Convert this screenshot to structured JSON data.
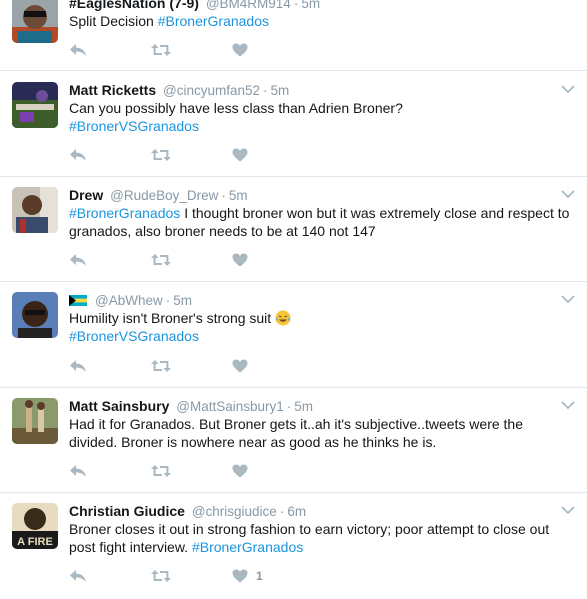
{
  "colors": {
    "accent": "#1b95e0",
    "muted": "#8899a6",
    "border": "#e1e8ed",
    "text": "#14171a"
  },
  "tweets": [
    {
      "name": "#EaglesNation (7-9)",
      "handle": "@BM4RM914",
      "time": "5m",
      "text_plain": "Split Decision",
      "hashtag": "#BronerGranados",
      "like_count": ""
    },
    {
      "name": "Matt Ricketts",
      "handle": "@cincyumfan52",
      "time": "5m",
      "text_plain": "Can you possibly have less class than Adrien Broner?",
      "hashtag": "#BronerVSGranados",
      "like_count": ""
    },
    {
      "name": "Drew",
      "handle": "@RudeBoy_Drew",
      "time": "5m",
      "hashtag": "#BronerGranados",
      "text_plain": "I thought broner won but it was extremely close and respect to granados, also broner needs to be at 140 not 147",
      "like_count": ""
    },
    {
      "name": "",
      "handle": "@AbWhew",
      "time": "5m",
      "text_plain": "Humility isn't Broner's strong suit",
      "hashtag": "#BronerVSGranados",
      "like_count": ""
    },
    {
      "name": "Matt Sainsbury",
      "handle": "@MattSainsbury1",
      "time": "5m",
      "text_plain": "Had it for Granados. But Broner gets it..ah it's subjective..tweets were the divided. Broner is nowhere near as good as he thinks he is.",
      "like_count": ""
    },
    {
      "name": "Christian Giudice",
      "handle": "@chrisgiudice",
      "time": "6m",
      "text_plain": "Broner closes it out in strong fashion to earn victory; poor attempt to close out post fight interview.",
      "hashtag": "#BronerGranados",
      "like_count": "1",
      "avatar_text": "A FIRE"
    }
  ],
  "icons": {
    "reply": "reply-icon",
    "retweet": "retweet-icon",
    "like": "heart-icon",
    "caret": "chevron-down-icon"
  }
}
